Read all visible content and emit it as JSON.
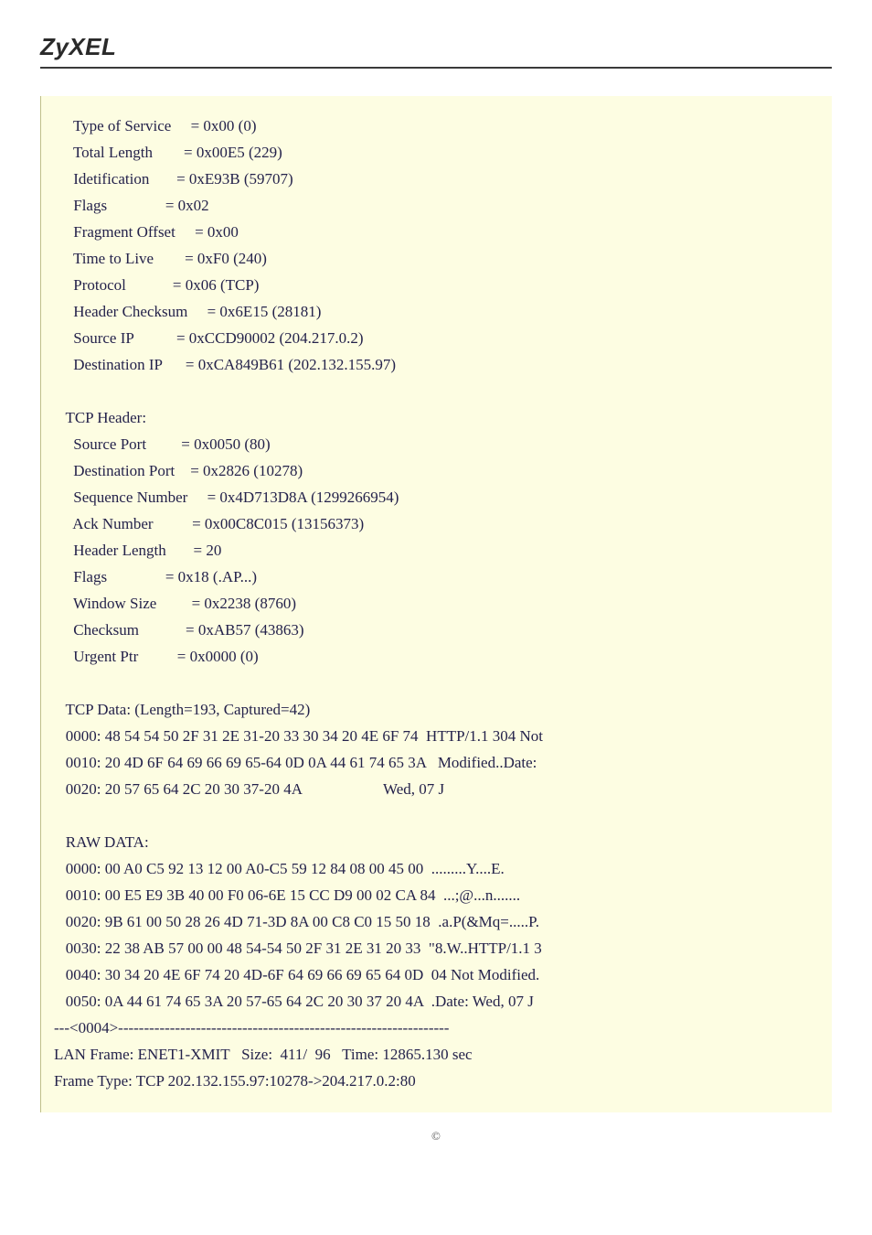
{
  "brand": "ZyXEL",
  "footer": "©",
  "dump_text": "     Type of Service     = 0x00 (0)\n     Total Length        = 0x00E5 (229)\n     Idetification       = 0xE93B (59707)\n     Flags               = 0x02\n     Fragment Offset     = 0x00\n     Time to Live        = 0xF0 (240)\n     Protocol            = 0x06 (TCP)\n     Header Checksum     = 0x6E15 (28181)\n     Source IP           = 0xCCD90002 (204.217.0.2)\n     Destination IP      = 0xCA849B61 (202.132.155.97)\n\n   TCP Header:\n     Source Port         = 0x0050 (80)\n     Destination Port    = 0x2826 (10278)\n     Sequence Number     = 0x4D713D8A (1299266954)\n     Ack Number          = 0x00C8C015 (13156373)\n     Header Length       = 20\n     Flags               = 0x18 (.AP...)\n     Window Size         = 0x2238 (8760)\n     Checksum            = 0xAB57 (43863)\n     Urgent Ptr          = 0x0000 (0)\n\n   TCP Data: (Length=193, Captured=42)\n   0000: 48 54 54 50 2F 31 2E 31-20 33 30 34 20 4E 6F 74  HTTP/1.1 304 Not\n   0010: 20 4D 6F 64 69 66 69 65-64 0D 0A 44 61 74 65 3A   Modified..Date:\n   0020: 20 57 65 64 2C 20 30 37-20 4A                     Wed, 07 J\n\n   RAW DATA:\n   0000: 00 A0 C5 92 13 12 00 A0-C5 59 12 84 08 00 45 00  .........Y....E.\n   0010: 00 E5 E9 3B 40 00 F0 06-6E 15 CC D9 00 02 CA 84  ...;@...n.......\n   0020: 9B 61 00 50 28 26 4D 71-3D 8A 00 C8 C0 15 50 18  .a.P(&Mq=.....P.\n   0030: 22 38 AB 57 00 00 48 54-54 50 2F 31 2E 31 20 33  \"8.W..HTTP/1.1 3\n   0040: 30 34 20 4E 6F 74 20 4D-6F 64 69 66 69 65 64 0D  04 Not Modified.\n   0050: 0A 44 61 74 65 3A 20 57-65 64 2C 20 30 37 20 4A  .Date: Wed, 07 J\n---<0004>----------------------------------------------------------------\nLAN Frame: ENET1-XMIT   Size:  411/  96   Time: 12865.130 sec\nFrame Type: TCP 202.132.155.97:10278->204.217.0.2:80\n"
}
